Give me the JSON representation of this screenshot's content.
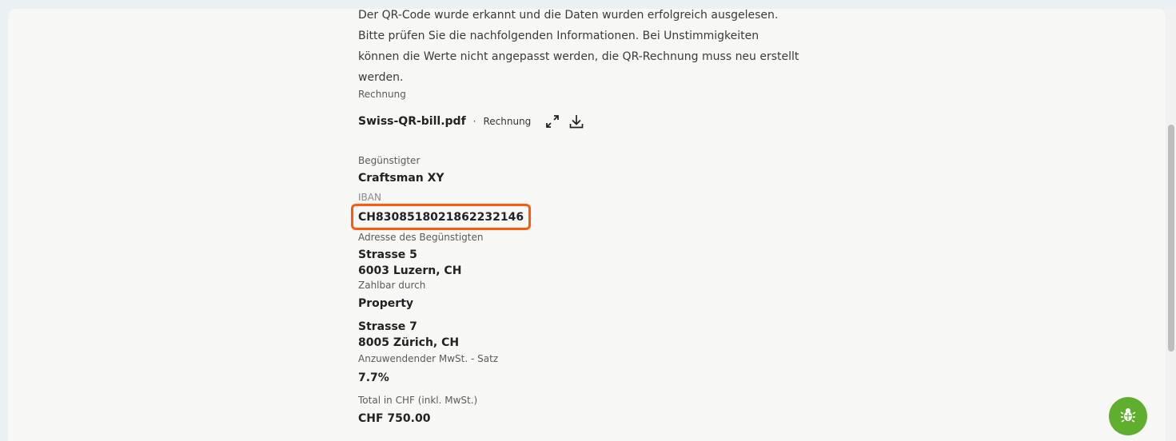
{
  "intro": {
    "line1": "Der QR-Code wurde erkannt und die Daten wurden erfolgreich ausgelesen.",
    "line2": "Bitte prüfen Sie die nachfolgenden Informationen. Bei Unstimmigkeiten",
    "line3": "können die Werte nicht angepasst werden, die QR-Rechnung muss neu erstellt",
    "line4": "werden."
  },
  "document": {
    "section_label": "Rechnung",
    "file_name": "Swiss-QR-bill.pdf",
    "separator": "·",
    "file_type": "Rechnung",
    "expand_icon": "expand-icon",
    "download_icon": "download-icon"
  },
  "fields": {
    "beneficiary_label": "Begünstigter",
    "beneficiary_value": "Craftsman XY",
    "iban_label": "IBAN",
    "iban_value": "CH8308518021862232146",
    "beneficiary_address_label": "Adresse des Begünstigten",
    "beneficiary_address_line1": "Strasse 5",
    "beneficiary_address_line2": "6003 Luzern, CH",
    "payable_by_label": "Zahlbar durch",
    "payable_by_name": "Property",
    "payable_by_address_line1": "Strasse 7",
    "payable_by_address_line2": "8005 Zürich, CH",
    "vat_rate_label": "Anzuwendender MwSt. - Satz",
    "vat_rate_value": "7.7%",
    "total_label": "Total in CHF (inkl. MwSt.)",
    "total_value": "CHF 750.00"
  },
  "colors": {
    "highlight": "#ff5a0a",
    "bug_button": "#5fae2e",
    "panel": "#f7f8f6",
    "background": "#eaf1f4"
  },
  "bug_button_icon": "bug-icon"
}
